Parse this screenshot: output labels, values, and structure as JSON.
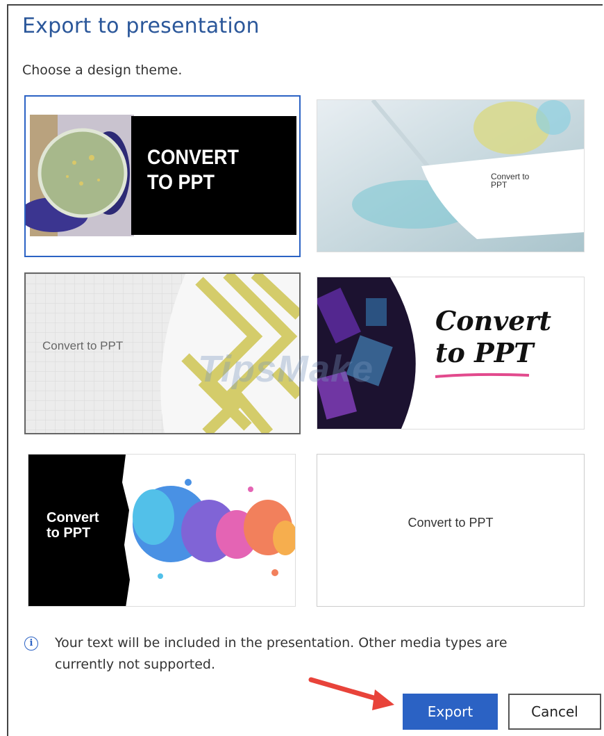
{
  "dialog": {
    "title": "Export to presentation",
    "subtitle": "Choose a design theme."
  },
  "themes": [
    {
      "label": "CONVERT TO PPT",
      "selected": true
    },
    {
      "label": "Convert to PPT",
      "selected": false
    },
    {
      "label": "Convert to PPT",
      "selected": false
    },
    {
      "label": "Convert to PPT",
      "selected": false
    },
    {
      "label": "Convert to PPT",
      "selected": false
    },
    {
      "label": "Convert to PPT",
      "selected": false
    }
  ],
  "info": {
    "icon": "info-icon",
    "text": "Your text will be included in the presentation. Other media types are currently not supported."
  },
  "buttons": {
    "export": "Export",
    "cancel": "Cancel"
  },
  "watermark": "TipsMake",
  "colors": {
    "accent": "#2b62c4",
    "title": "#2b579a",
    "arrow": "#e8433a"
  }
}
